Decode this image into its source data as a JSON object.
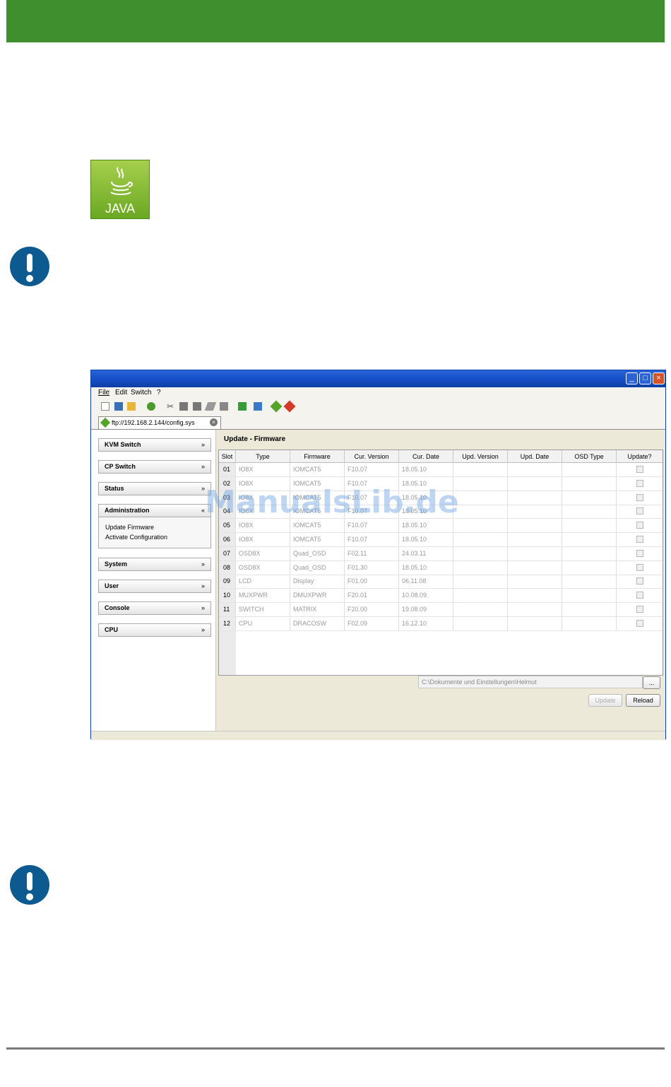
{
  "app": {
    "title": "",
    "menu": [
      "File",
      "Edit",
      "Switch",
      "?"
    ],
    "tab_label": "ftp://192.168.2.144/config.sys",
    "sidebar": [
      {
        "label": "KVM Switch",
        "chev": "»"
      },
      {
        "label": "CP Switch",
        "chev": "»"
      },
      {
        "label": "Status",
        "chev": "»"
      },
      {
        "label": "Administration",
        "chev": "«"
      },
      {
        "label": "System",
        "chev": "»"
      },
      {
        "label": "User",
        "chev": "»"
      },
      {
        "label": "Console",
        "chev": "»"
      },
      {
        "label": "CPU",
        "chev": "»"
      }
    ],
    "admin_items": [
      "Update Firmware",
      "Activate Configuration"
    ],
    "main_title": "Update - Firmware",
    "columns": [
      "Slot",
      "Type",
      "Firmware",
      "Cur. Version",
      "Cur. Date",
      "Upd. Version",
      "Upd. Date",
      "OSD Type",
      "Update?"
    ],
    "rows": [
      [
        "01",
        "IO8X",
        "IOMCAT5",
        "F10.07",
        "18.05.10"
      ],
      [
        "02",
        "IO8X",
        "IOMCAT5",
        "F10.07",
        "18.05.10"
      ],
      [
        "03",
        "IO8X",
        "IOMCAT5",
        "F10.07",
        "18.05.10"
      ],
      [
        "04",
        "IO8X",
        "IOMCAT5",
        "F10.07",
        "18.05.10"
      ],
      [
        "05",
        "IO8X",
        "IOMCAT5",
        "F10.07",
        "18.05.10"
      ],
      [
        "06",
        "IO8X",
        "IOMCAT5",
        "F10.07",
        "18.05.10"
      ],
      [
        "07",
        "OSD8X",
        "Quad_OSD",
        "F02.11",
        "24.03.11"
      ],
      [
        "08",
        "OSD8X",
        "Quad_OSD",
        "F01.30",
        "18.05.10"
      ],
      [
        "09",
        "LCD",
        "Display",
        "F01.00",
        "06.11.08"
      ],
      [
        "10",
        "MUXPWR",
        "DMUXPWR",
        "F20.01",
        "10.08.09"
      ],
      [
        "11",
        "SWITCH",
        "MATRIX",
        "F20.00",
        "19.08.09"
      ],
      [
        "12",
        "CPU",
        "DRACOSW",
        "F02.09",
        "16.12.10"
      ]
    ],
    "path_value": "C:\\Dokumente und Einstellungen\\Helmut",
    "browse_label": "...",
    "update_label": "Update",
    "reload_label": "Reload"
  },
  "logo_text": "JAVA",
  "watermark": "ManualsLib.de",
  "colors": {
    "header_bar": "#3f8f2e",
    "warning_icon": "#0c5a8f",
    "java_green": "#8bc34a"
  },
  "icons": [
    "java-cup-icon",
    "exclamation-icon",
    "exclamation-icon"
  ]
}
